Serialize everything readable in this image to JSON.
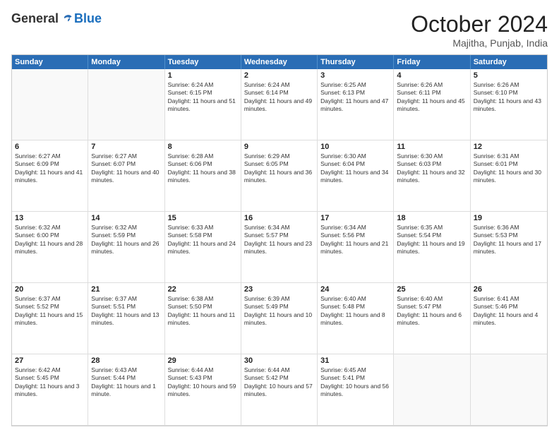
{
  "header": {
    "logo": {
      "general": "General",
      "blue": "Blue"
    },
    "title": "October 2024",
    "location": "Majitha, Punjab, India"
  },
  "calendar": {
    "days_of_week": [
      "Sunday",
      "Monday",
      "Tuesday",
      "Wednesday",
      "Thursday",
      "Friday",
      "Saturday"
    ],
    "weeks": [
      [
        {
          "day": "",
          "empty": true
        },
        {
          "day": "",
          "empty": true
        },
        {
          "day": "1",
          "sunrise": "Sunrise: 6:24 AM",
          "sunset": "Sunset: 6:15 PM",
          "daylight": "Daylight: 11 hours and 51 minutes."
        },
        {
          "day": "2",
          "sunrise": "Sunrise: 6:24 AM",
          "sunset": "Sunset: 6:14 PM",
          "daylight": "Daylight: 11 hours and 49 minutes."
        },
        {
          "day": "3",
          "sunrise": "Sunrise: 6:25 AM",
          "sunset": "Sunset: 6:13 PM",
          "daylight": "Daylight: 11 hours and 47 minutes."
        },
        {
          "day": "4",
          "sunrise": "Sunrise: 6:26 AM",
          "sunset": "Sunset: 6:11 PM",
          "daylight": "Daylight: 11 hours and 45 minutes."
        },
        {
          "day": "5",
          "sunrise": "Sunrise: 6:26 AM",
          "sunset": "Sunset: 6:10 PM",
          "daylight": "Daylight: 11 hours and 43 minutes."
        }
      ],
      [
        {
          "day": "6",
          "sunrise": "Sunrise: 6:27 AM",
          "sunset": "Sunset: 6:09 PM",
          "daylight": "Daylight: 11 hours and 41 minutes."
        },
        {
          "day": "7",
          "sunrise": "Sunrise: 6:27 AM",
          "sunset": "Sunset: 6:07 PM",
          "daylight": "Daylight: 11 hours and 40 minutes."
        },
        {
          "day": "8",
          "sunrise": "Sunrise: 6:28 AM",
          "sunset": "Sunset: 6:06 PM",
          "daylight": "Daylight: 11 hours and 38 minutes."
        },
        {
          "day": "9",
          "sunrise": "Sunrise: 6:29 AM",
          "sunset": "Sunset: 6:05 PM",
          "daylight": "Daylight: 11 hours and 36 minutes."
        },
        {
          "day": "10",
          "sunrise": "Sunrise: 6:30 AM",
          "sunset": "Sunset: 6:04 PM",
          "daylight": "Daylight: 11 hours and 34 minutes."
        },
        {
          "day": "11",
          "sunrise": "Sunrise: 6:30 AM",
          "sunset": "Sunset: 6:03 PM",
          "daylight": "Daylight: 11 hours and 32 minutes."
        },
        {
          "day": "12",
          "sunrise": "Sunrise: 6:31 AM",
          "sunset": "Sunset: 6:01 PM",
          "daylight": "Daylight: 11 hours and 30 minutes."
        }
      ],
      [
        {
          "day": "13",
          "sunrise": "Sunrise: 6:32 AM",
          "sunset": "Sunset: 6:00 PM",
          "daylight": "Daylight: 11 hours and 28 minutes."
        },
        {
          "day": "14",
          "sunrise": "Sunrise: 6:32 AM",
          "sunset": "Sunset: 5:59 PM",
          "daylight": "Daylight: 11 hours and 26 minutes."
        },
        {
          "day": "15",
          "sunrise": "Sunrise: 6:33 AM",
          "sunset": "Sunset: 5:58 PM",
          "daylight": "Daylight: 11 hours and 24 minutes."
        },
        {
          "day": "16",
          "sunrise": "Sunrise: 6:34 AM",
          "sunset": "Sunset: 5:57 PM",
          "daylight": "Daylight: 11 hours and 23 minutes."
        },
        {
          "day": "17",
          "sunrise": "Sunrise: 6:34 AM",
          "sunset": "Sunset: 5:56 PM",
          "daylight": "Daylight: 11 hours and 21 minutes."
        },
        {
          "day": "18",
          "sunrise": "Sunrise: 6:35 AM",
          "sunset": "Sunset: 5:54 PM",
          "daylight": "Daylight: 11 hours and 19 minutes."
        },
        {
          "day": "19",
          "sunrise": "Sunrise: 6:36 AM",
          "sunset": "Sunset: 5:53 PM",
          "daylight": "Daylight: 11 hours and 17 minutes."
        }
      ],
      [
        {
          "day": "20",
          "sunrise": "Sunrise: 6:37 AM",
          "sunset": "Sunset: 5:52 PM",
          "daylight": "Daylight: 11 hours and 15 minutes."
        },
        {
          "day": "21",
          "sunrise": "Sunrise: 6:37 AM",
          "sunset": "Sunset: 5:51 PM",
          "daylight": "Daylight: 11 hours and 13 minutes."
        },
        {
          "day": "22",
          "sunrise": "Sunrise: 6:38 AM",
          "sunset": "Sunset: 5:50 PM",
          "daylight": "Daylight: 11 hours and 11 minutes."
        },
        {
          "day": "23",
          "sunrise": "Sunrise: 6:39 AM",
          "sunset": "Sunset: 5:49 PM",
          "daylight": "Daylight: 11 hours and 10 minutes."
        },
        {
          "day": "24",
          "sunrise": "Sunrise: 6:40 AM",
          "sunset": "Sunset: 5:48 PM",
          "daylight": "Daylight: 11 hours and 8 minutes."
        },
        {
          "day": "25",
          "sunrise": "Sunrise: 6:40 AM",
          "sunset": "Sunset: 5:47 PM",
          "daylight": "Daylight: 11 hours and 6 minutes."
        },
        {
          "day": "26",
          "sunrise": "Sunrise: 6:41 AM",
          "sunset": "Sunset: 5:46 PM",
          "daylight": "Daylight: 11 hours and 4 minutes."
        }
      ],
      [
        {
          "day": "27",
          "sunrise": "Sunrise: 6:42 AM",
          "sunset": "Sunset: 5:45 PM",
          "daylight": "Daylight: 11 hours and 3 minutes."
        },
        {
          "day": "28",
          "sunrise": "Sunrise: 6:43 AM",
          "sunset": "Sunset: 5:44 PM",
          "daylight": "Daylight: 11 hours and 1 minute."
        },
        {
          "day": "29",
          "sunrise": "Sunrise: 6:44 AM",
          "sunset": "Sunset: 5:43 PM",
          "daylight": "Daylight: 10 hours and 59 minutes."
        },
        {
          "day": "30",
          "sunrise": "Sunrise: 6:44 AM",
          "sunset": "Sunset: 5:42 PM",
          "daylight": "Daylight: 10 hours and 57 minutes."
        },
        {
          "day": "31",
          "sunrise": "Sunrise: 6:45 AM",
          "sunset": "Sunset: 5:41 PM",
          "daylight": "Daylight: 10 hours and 56 minutes."
        },
        {
          "day": "",
          "empty": true
        },
        {
          "day": "",
          "empty": true
        }
      ]
    ]
  }
}
